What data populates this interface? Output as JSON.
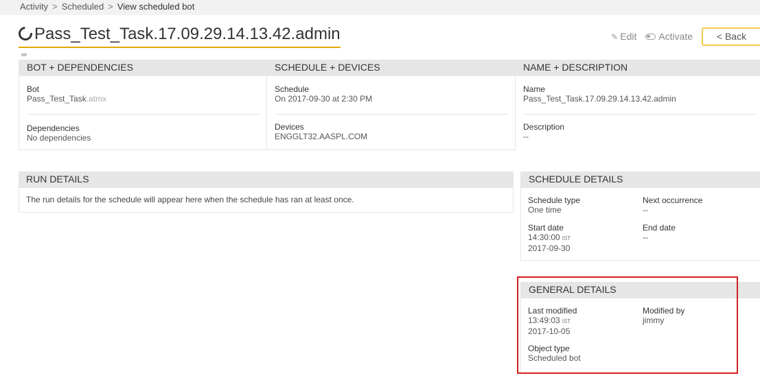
{
  "breadcrumb": {
    "items": [
      "Activity",
      "Scheduled",
      "View scheduled bot"
    ],
    "separator": ">"
  },
  "header": {
    "title": "Pass_Test_Task.17.09.29.14.13.42.admin",
    "edit_label": "Edit",
    "activate_label": "Activate",
    "back_label": "< Back"
  },
  "bot_dependencies": {
    "heading": "BOT + DEPENDENCIES",
    "bot_label": "Bot",
    "bot_name": "Pass_Test_Task",
    "bot_ext": ".atmx",
    "dependencies_label": "Dependencies",
    "dependencies_value": "No dependencies"
  },
  "schedule_devices": {
    "heading": "SCHEDULE + DEVICES",
    "schedule_label": "Schedule",
    "schedule_value": "On 2017-09-30 at 2:30 PM",
    "devices_label": "Devices",
    "devices_value": "ENGGLT32.AASPL.COM"
  },
  "name_description": {
    "heading": "NAME + DESCRIPTION",
    "name_label": "Name",
    "name_value": "Pass_Test_Task.17.09.29.14.13.42.admin",
    "description_label": "Description",
    "description_value": "--"
  },
  "run_details": {
    "heading": "RUN DETAILS",
    "message": "The run details for the schedule will appear here when the schedule has ran at least once."
  },
  "schedule_details": {
    "heading": "SCHEDULE DETAILS",
    "schedule_type_label": "Schedule type",
    "schedule_type_value": "One time",
    "next_occurrence_label": "Next occurrence",
    "next_occurrence_value": "--",
    "start_date_label": "Start date",
    "start_time": "14:30:00",
    "timezone": "IST",
    "start_date": "2017-09-30",
    "end_date_label": "End date",
    "end_date_value": "--"
  },
  "general_details": {
    "heading": "GENERAL DETAILS",
    "last_modified_label": "Last modified",
    "last_modified_time": "13:49:03",
    "timezone": "IST",
    "last_modified_date": "2017-10-05",
    "modified_by_label": "Modified by",
    "modified_by_value": "jimmy",
    "object_type_label": "Object type",
    "object_type_value": "Scheduled bot"
  },
  "colors": {
    "accent": "#e0a800",
    "back_border": "#f2c94c",
    "highlight_box": "#d21f1f",
    "section_header_bg": "#e6e6e6"
  },
  "icons": [
    "spinner-ring-icon",
    "link-icon",
    "pencil-icon",
    "toggle-icon"
  ]
}
